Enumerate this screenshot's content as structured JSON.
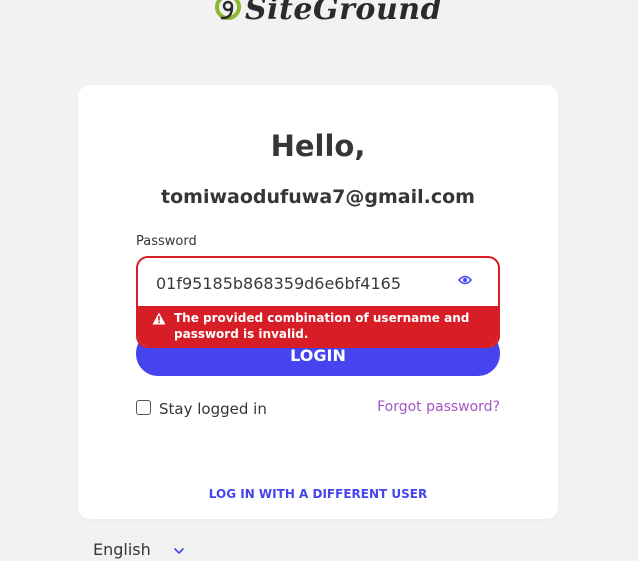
{
  "brand": {
    "name": "SiteGround",
    "accent": "#4544ef",
    "error_color": "#d71d25",
    "link_color": "#a057c4",
    "logo_green": "#8ab832"
  },
  "login": {
    "greeting": "Hello,",
    "email": "tomiwaodufuwa7@gmail.com",
    "password_label": "Password",
    "password_value": "01f95185b868359d6e6bf4165",
    "toggle_visibility_icon": "eye-icon",
    "error_icon": "warning-icon",
    "error_message": "The provided combination of username and password is invalid.",
    "submit_label": "LOGIN",
    "stay_logged_in_label": "Stay logged in",
    "stay_logged_in_checked": false,
    "forgot_password_label": "Forgot password?",
    "different_user_label": "LOG IN WITH A DIFFERENT USER"
  },
  "footer": {
    "language": "English",
    "language_icon": "chevron-down-icon"
  }
}
